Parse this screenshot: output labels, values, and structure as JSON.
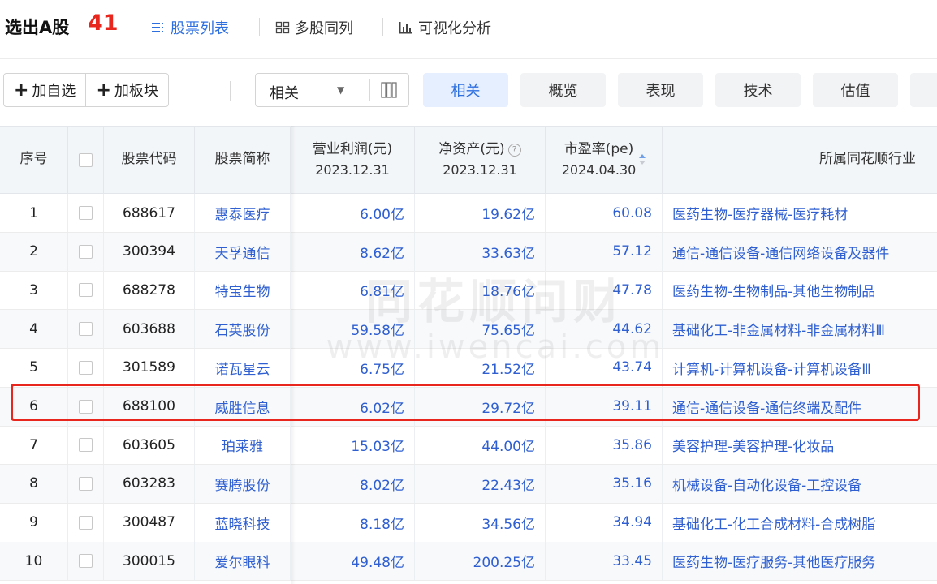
{
  "header": {
    "title": "选出A股",
    "count": "41",
    "tabs": [
      {
        "label": "股票列表",
        "icon": "list-icon",
        "active": true
      },
      {
        "label": "多股同列",
        "icon": "grid-icon",
        "active": false
      },
      {
        "label": "可视化分析",
        "icon": "bar-chart-icon",
        "active": false
      }
    ]
  },
  "toolbar": {
    "add_watchlist": "加自选",
    "add_sector": "加板块",
    "select_value": "相关",
    "tag_tabs": [
      "相关",
      "概览",
      "表现",
      "技术",
      "估值"
    ]
  },
  "table": {
    "headers": {
      "index": "序号",
      "code": "股票代码",
      "name": "股票简称",
      "op_profit": "营业利润(元)",
      "op_profit_date": "2023.12.31",
      "net_assets": "净资产(元)",
      "net_assets_date": "2023.12.31",
      "pe": "市盈率(pe)",
      "pe_date": "2024.04.30",
      "industry": "所属同花顺行业"
    },
    "rows": [
      {
        "index": "1",
        "code": "688617",
        "name": "惠泰医疗",
        "op_profit": "6.00亿",
        "net_assets": "19.62亿",
        "pe": "60.08",
        "industry": "医药生物-医疗器械-医疗耗材"
      },
      {
        "index": "2",
        "code": "300394",
        "name": "天孚通信",
        "op_profit": "8.62亿",
        "net_assets": "33.63亿",
        "pe": "57.12",
        "industry": "通信-通信设备-通信网络设备及器件"
      },
      {
        "index": "3",
        "code": "688278",
        "name": "特宝生物",
        "op_profit": "6.81亿",
        "net_assets": "18.76亿",
        "pe": "47.78",
        "industry": "医药生物-生物制品-其他生物制品"
      },
      {
        "index": "4",
        "code": "603688",
        "name": "石英股份",
        "op_profit": "59.58亿",
        "net_assets": "75.65亿",
        "pe": "44.62",
        "industry": "基础化工-非金属材料-非金属材料Ⅲ"
      },
      {
        "index": "5",
        "code": "301589",
        "name": "诺瓦星云",
        "op_profit": "6.75亿",
        "net_assets": "21.52亿",
        "pe": "43.74",
        "industry": "计算机-计算机设备-计算机设备Ⅲ"
      },
      {
        "index": "6",
        "code": "688100",
        "name": "威胜信息",
        "op_profit": "6.02亿",
        "net_assets": "29.72亿",
        "pe": "39.11",
        "industry": "通信-通信设备-通信终端及配件"
      },
      {
        "index": "7",
        "code": "603605",
        "name": "珀莱雅",
        "op_profit": "15.03亿",
        "net_assets": "44.00亿",
        "pe": "35.86",
        "industry": "美容护理-美容护理-化妆品"
      },
      {
        "index": "8",
        "code": "603283",
        "name": "赛腾股份",
        "op_profit": "8.02亿",
        "net_assets": "22.43亿",
        "pe": "35.16",
        "industry": "机械设备-自动化设备-工控设备"
      },
      {
        "index": "9",
        "code": "300487",
        "name": "蓝晓科技",
        "op_profit": "8.18亿",
        "net_assets": "34.56亿",
        "pe": "34.94",
        "industry": "基础化工-化工合成材料-合成树脂"
      },
      {
        "index": "10",
        "code": "300015",
        "name": "爱尔眼科",
        "op_profit": "49.48亿",
        "net_assets": "200.25亿",
        "pe": "33.45",
        "industry": "医药生物-医疗服务-其他医疗服务"
      }
    ]
  },
  "watermark": {
    "line1": "同花顺问财",
    "line2": "www.iwencai.com"
  },
  "colors": {
    "accent": "#2e6fe0",
    "count_red": "#e8261e",
    "link_blue": "#2f5fd0",
    "highlight_red": "#e8261e"
  }
}
